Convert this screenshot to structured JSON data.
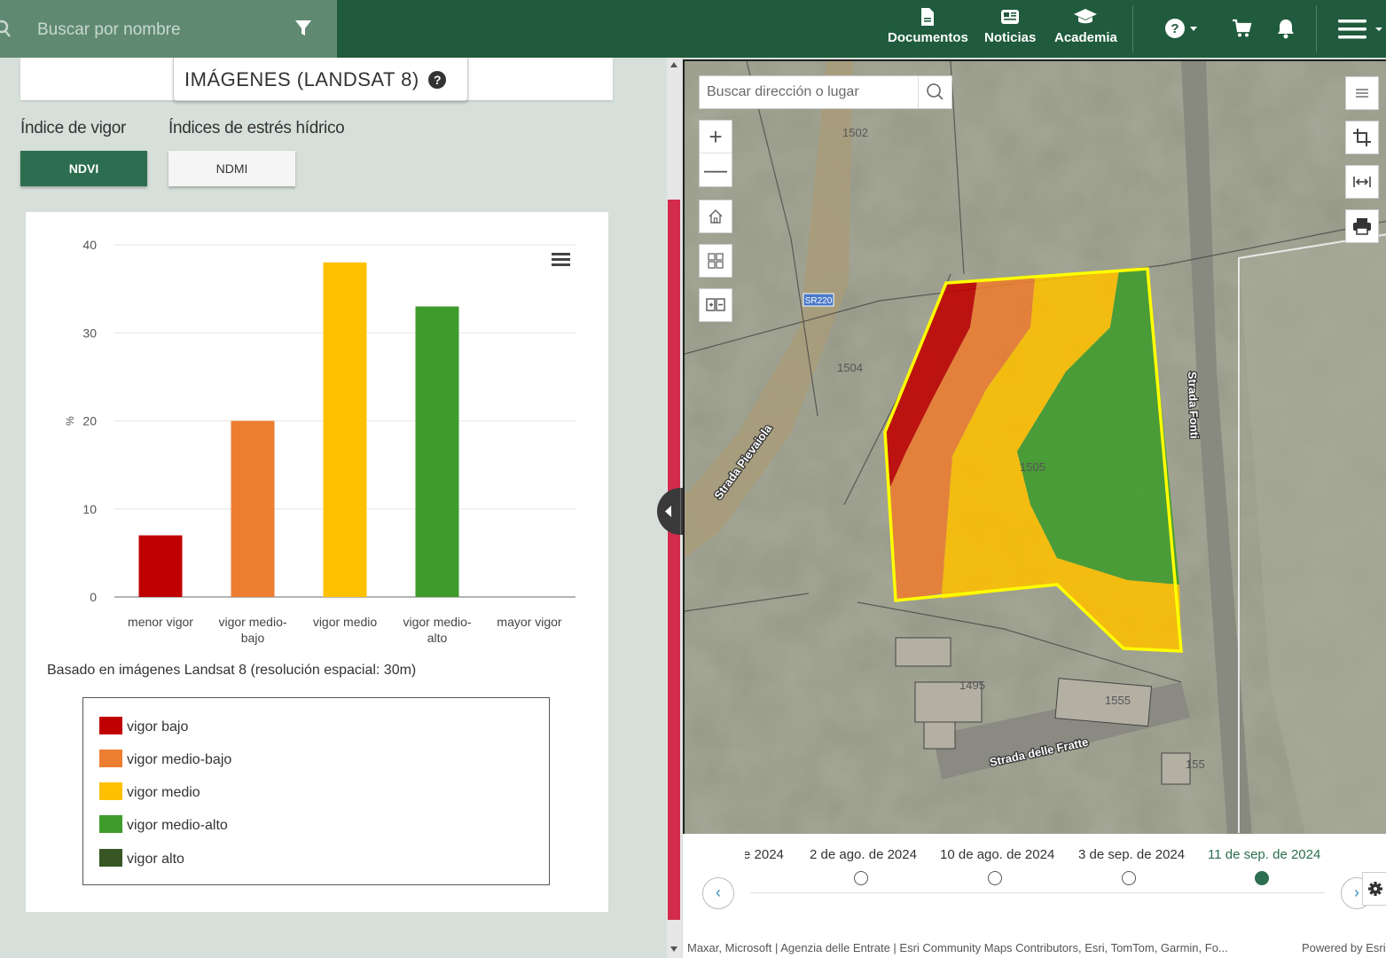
{
  "topbar": {
    "search_placeholder": "Buscar por nombre",
    "nav": [
      {
        "label": "Documentos",
        "icon": "document-icon"
      },
      {
        "label": "Noticias",
        "icon": "newspaper-icon"
      },
      {
        "label": "Academia",
        "icon": "graduation-cap-icon"
      }
    ],
    "icons": [
      "help-icon",
      "cart-icon",
      "bell-icon",
      "hamburger-menu-icon"
    ]
  },
  "panel": {
    "tab_title": "IMÁGENES (LANDSAT 8)",
    "vigor_label": "Índice de vigor",
    "water_label": "Índices de estrés hídrico",
    "ndvi_button": "NDVI",
    "ndmi_button": "NDMI",
    "basis_note": "Basado en imágenes Landsat 8 (resolución espacial: 30m)",
    "legend": [
      {
        "label": "vigor bajo",
        "color": "#c00000"
      },
      {
        "label": "vigor medio-bajo",
        "color": "#ed7d31"
      },
      {
        "label": "vigor medio",
        "color": "#ffc000"
      },
      {
        "label": "vigor medio-alto",
        "color": "#3f9c2c"
      },
      {
        "label": "vigor alto",
        "color": "#375623"
      }
    ]
  },
  "chart_data": {
    "type": "bar",
    "categories": [
      "menor vigor",
      "vigor medio-bajo",
      "vigor medio",
      "vigor medio-alto",
      "mayor vigor"
    ],
    "category_lines": [
      [
        "menor vigor"
      ],
      [
        "vigor medio-",
        "bajo"
      ],
      [
        "vigor medio"
      ],
      [
        "vigor medio-",
        "alto"
      ],
      [
        "mayor vigor"
      ]
    ],
    "values": [
      7,
      20,
      38,
      33,
      0
    ],
    "colors": [
      "#c00000",
      "#ed7d31",
      "#ffc000",
      "#3f9c2c",
      "#375623"
    ],
    "ylabel": "%",
    "ylim": [
      0,
      40
    ],
    "yticks": [
      0,
      10,
      20,
      30,
      40
    ],
    "grid": true
  },
  "map": {
    "search_placeholder": "Buscar dirección o lugar",
    "labels": {
      "road1": "Strada Pievaiola",
      "road2": "Strada Fonti",
      "road3": "Strada delle Fratte",
      "shield": "SR220",
      "parcel_1502": "1502",
      "parcel_1504": "1504",
      "parcel_1505": "1505",
      "parcel_1495": "1495",
      "parcel_1555": "1555",
      "parcel_155x": "155"
    },
    "tools": [
      "list-icon",
      "crop-icon",
      "measure-icon",
      "print-icon"
    ],
    "left_tools": [
      "zoom-in-icon",
      "zoom-out-icon",
      "home-icon",
      "grid-icon",
      "compare-icon"
    ]
  },
  "timeline": {
    "dates": [
      "2024",
      "2 de ago. de 2024",
      "10 de ago. de 2024",
      "3 de sep. de 2024",
      "11 de sep. de 2024"
    ],
    "partial_prefix": "e",
    "active_index": 4,
    "active_color": "#2c6e4f",
    "attribution": "Maxar, Microsoft | Agenzia delle Entrate | Esri Community Maps Contributors, Esri, TomTom, Garmin, Fo...",
    "powered": "Powered by Esri"
  }
}
